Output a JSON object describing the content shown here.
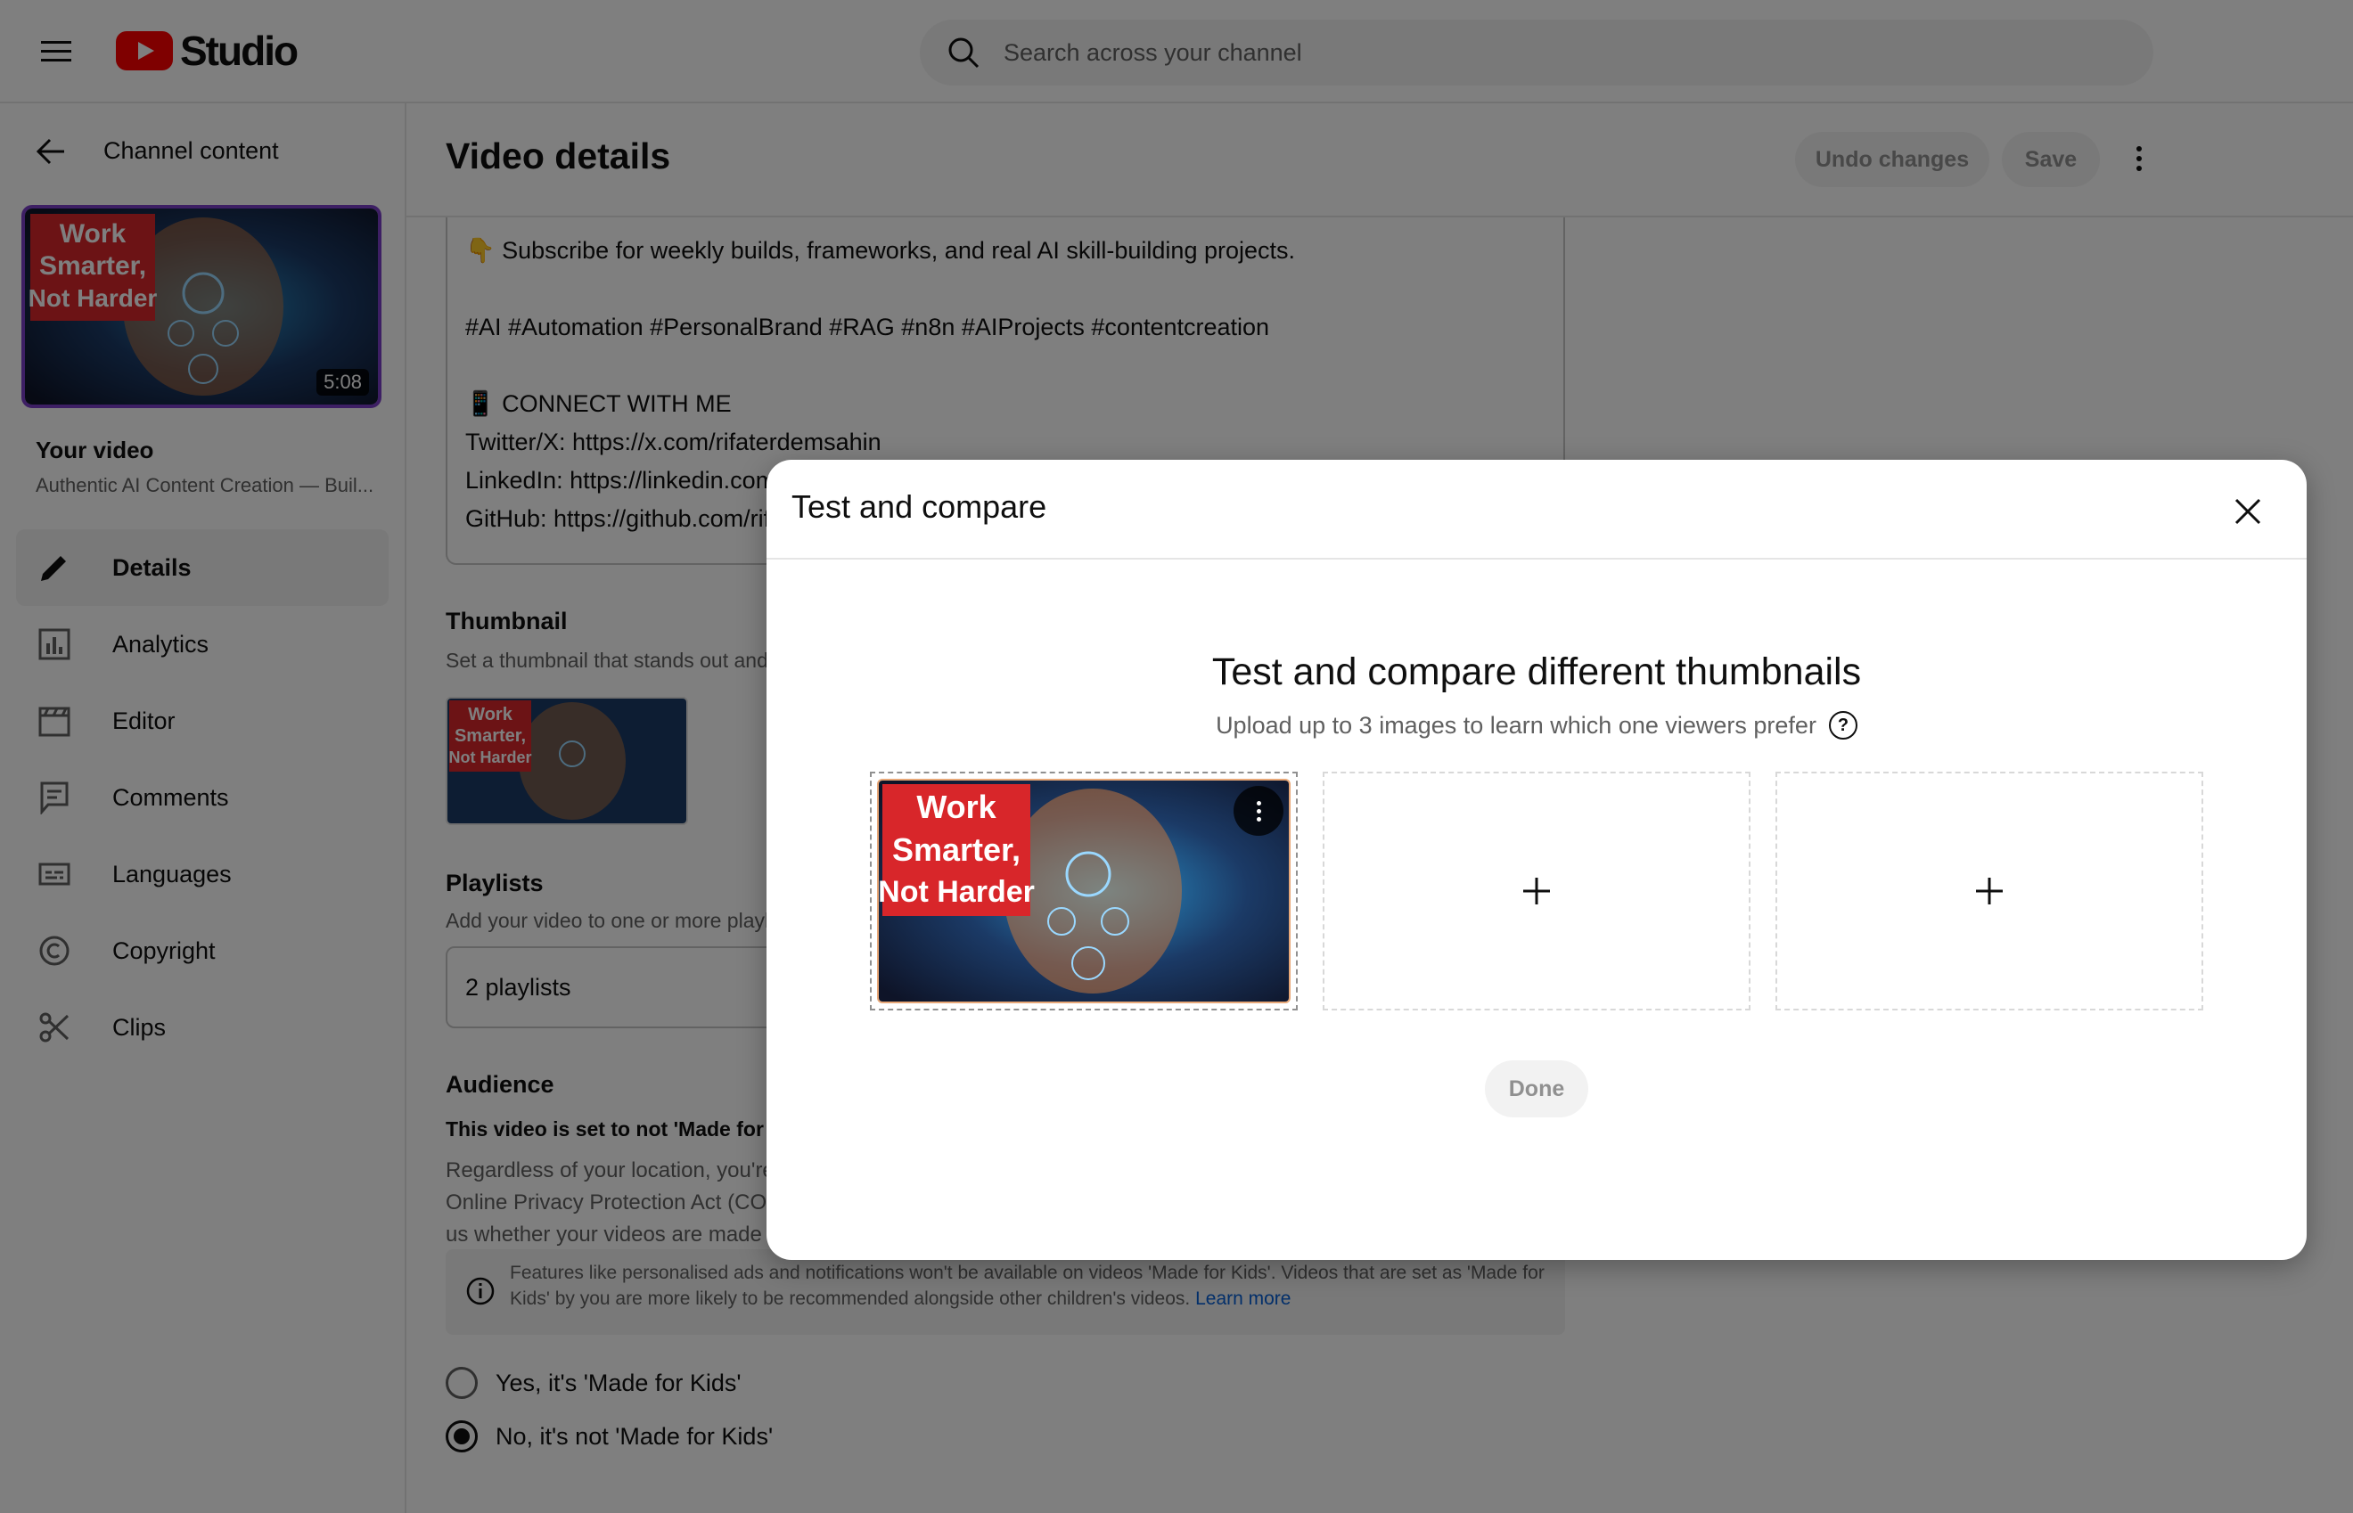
{
  "header": {
    "logo_text": "Studio",
    "search_placeholder": "Search across your channel"
  },
  "sidebar": {
    "back_label": "Channel content",
    "thumbnail_duration": "5:08",
    "thumbnail_text": [
      "Work",
      "Smarter,",
      "Not Harder"
    ],
    "your_video_label": "Your video",
    "video_title": "Authentic AI Content Creation — Buil...",
    "items": [
      {
        "label": "Details",
        "icon": "pencil-icon",
        "active": true
      },
      {
        "label": "Analytics",
        "icon": "analytics-icon",
        "active": false
      },
      {
        "label": "Editor",
        "icon": "clapperboard-icon",
        "active": false
      },
      {
        "label": "Comments",
        "icon": "comment-icon",
        "active": false
      },
      {
        "label": "Languages",
        "icon": "subtitles-icon",
        "active": false
      },
      {
        "label": "Copyright",
        "icon": "copyright-icon",
        "active": false
      },
      {
        "label": "Clips",
        "icon": "scissors-icon",
        "active": false
      }
    ]
  },
  "main": {
    "page_title": "Video details",
    "undo_label": "Undo changes",
    "save_label": "Save",
    "description_lines": [
      "👇 Subscribe for weekly builds, frameworks, and real AI skill-building projects.",
      "",
      "#AI #Automation #PersonalBrand #RAG #n8n #AIProjects #contentcreation",
      "",
      "📱 CONNECT WITH ME",
      "Twitter/X: https://x.com/rifaterdemsahin",
      "LinkedIn:   https://linkedin.com/in/rifaterdemsahin",
      "GitHub: https://github.com/rifaterdemsahin"
    ],
    "thumbnail_title": "Thumbnail",
    "thumbnail_sub": "Set a thumbnail that stands out and draws viewers' attention.",
    "playlists_title": "Playlists",
    "playlists_sub": "Add your video to one or more playlists.",
    "playlists_value": "2 playlists",
    "audience_title": "Audience",
    "audience_bold": "This video is set to not 'Made for Kids'",
    "audience_text": "Regardless of your location, you're legally required to comply with the Children's Online Privacy Protection Act (COPPA) and/or other laws. You're required to tell us whether your videos are made for kids.",
    "info_text": "Features like personalised ads and notifications won't be available on videos 'Made for Kids'. Videos that are set as 'Made for Kids' by you are more likely to be recommended alongside other children's videos.",
    "learn_more": "Learn more",
    "radio_yes": "Yes, it's 'Made for Kids'",
    "radio_no": "No, it's not 'Made for Kids'"
  },
  "dialog": {
    "title": "Test and compare",
    "heading": "Test and compare different thumbnails",
    "subheading": "Upload up to 3 images to learn which one viewers prefer",
    "help_glyph": "?",
    "done_label": "Done"
  }
}
